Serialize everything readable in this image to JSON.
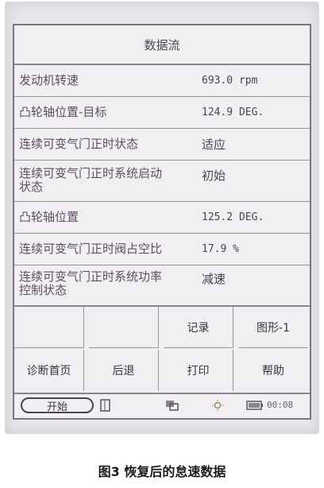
{
  "screen": {
    "title": "数据流",
    "rows": [
      {
        "label": "发动机转速",
        "value": "693.0 rpm"
      },
      {
        "label": "凸轮轴位置-目标",
        "value": "124.9 DEG."
      },
      {
        "label": "连续可变气门正时状态",
        "value": "适应"
      },
      {
        "label": "连续可变气门正时系统启动状态",
        "value": "初始"
      },
      {
        "label": "凸轮轴位置",
        "value": "125.2 DEG."
      },
      {
        "label": "连续可变气门正时阀占空比",
        "value": "17.9 %"
      },
      {
        "label": "连续可变气门正时系统功率控制状态",
        "value": "减速"
      }
    ],
    "buttons": [
      {
        "label": "",
        "faded": true
      },
      {
        "label": "",
        "faded": true
      },
      {
        "label": "记录"
      },
      {
        "label": "图形-1"
      },
      {
        "label": "诊断首页"
      },
      {
        "label": "后退"
      },
      {
        "label": "打印"
      },
      {
        "label": "帮助"
      }
    ],
    "statusbar": {
      "start_label": "开始",
      "clock": "00:08",
      "icons": [
        "document-icon",
        "windows-icon",
        "brightness-icon",
        "battery-icon"
      ]
    }
  },
  "caption": "图3 恢复后的怠速数据"
}
